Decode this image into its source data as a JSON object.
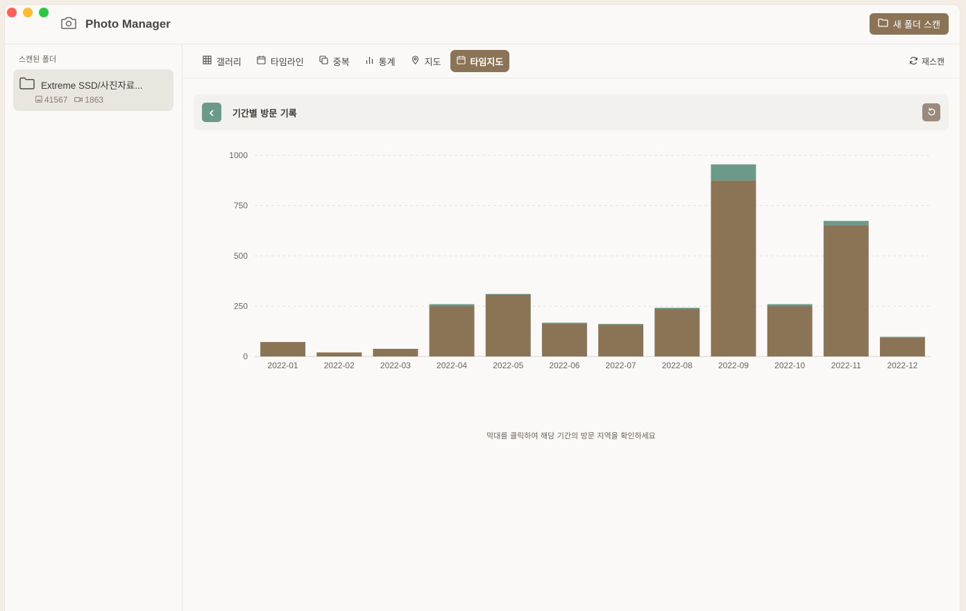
{
  "app": {
    "title": "Photo Manager",
    "new_scan_label": "새 폴더 스캔"
  },
  "sidebar": {
    "header": "스캔된 폴더",
    "folder": {
      "name": "Extreme SSD/사진자료...",
      "photo_count": "41567",
      "video_count": "1863"
    }
  },
  "tabs": [
    {
      "label": "갤러리",
      "icon": "grid-icon"
    },
    {
      "label": "타임라인",
      "icon": "calendar-icon"
    },
    {
      "label": "중복",
      "icon": "copy-icon"
    },
    {
      "label": "통계",
      "icon": "bar-chart-icon"
    },
    {
      "label": "지도",
      "icon": "map-pin-icon"
    },
    {
      "label": "타임지도",
      "icon": "calendar-icon",
      "active": true
    }
  ],
  "rescan_label": "재스캔",
  "panel": {
    "title": "기간별 방문 기록"
  },
  "hint": "막대를 클릭하여 해당 기간의 방문 지역을 확인하세요",
  "colors": {
    "accent": "#8b7355",
    "secondary": "#6b9a8b",
    "grid": "#e5e1dc"
  },
  "chart_data": {
    "type": "bar",
    "stacked": true,
    "categories": [
      "2022-01",
      "2022-02",
      "2022-03",
      "2022-04",
      "2022-05",
      "2022-06",
      "2022-07",
      "2022-08",
      "2022-09",
      "2022-10",
      "2022-11",
      "2022-12"
    ],
    "series": [
      {
        "values": [
          72,
          20,
          38,
          250,
          307,
          162,
          158,
          236,
          875,
          250,
          652,
          94
        ],
        "color": "#8b7355"
      },
      {
        "values": [
          0,
          0,
          0,
          10,
          4,
          6,
          4,
          6,
          80,
          10,
          22,
          4
        ],
        "color": "#6b9a8b"
      }
    ],
    "ylim": [
      0,
      1000
    ],
    "yticks": [
      0,
      250,
      500,
      750,
      1000
    ],
    "grid": true,
    "legend": false
  }
}
